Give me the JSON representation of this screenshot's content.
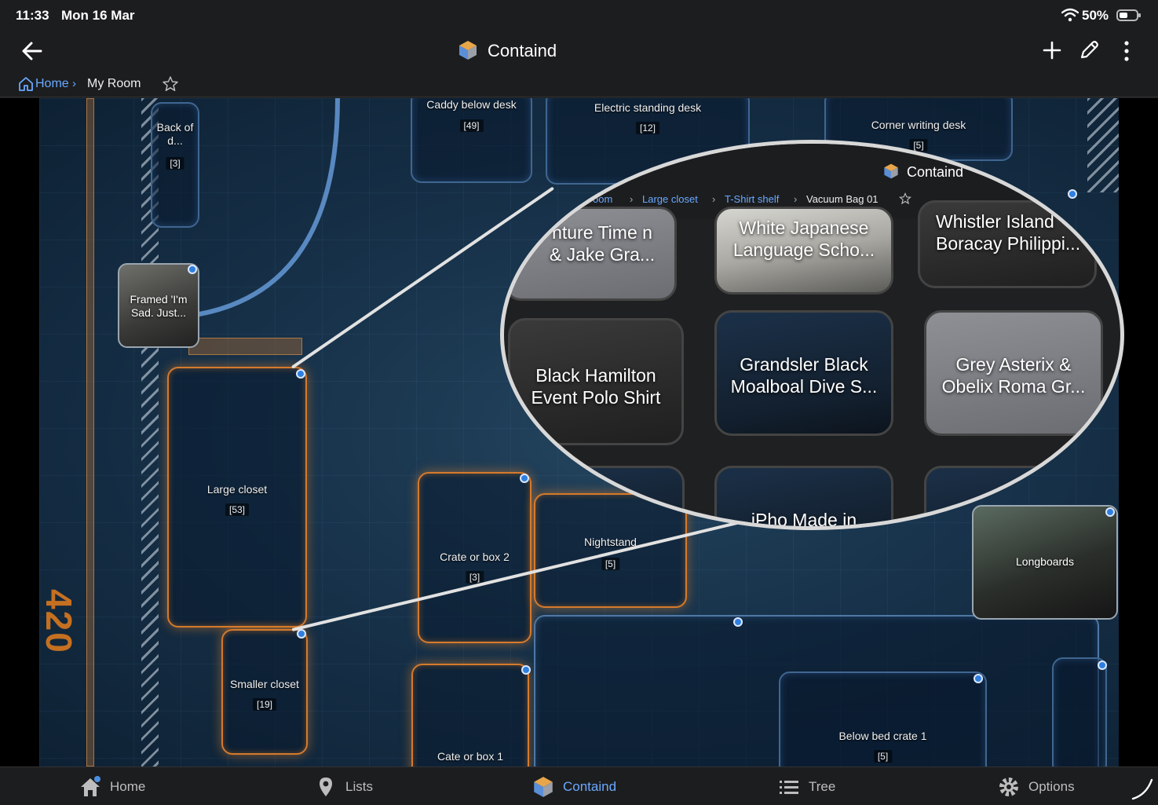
{
  "status_bar": {
    "time": "11:33",
    "date": "Mon 16 Mar",
    "battery": "50%"
  },
  "app_bar": {
    "title": "Containd"
  },
  "breadcrumb": {
    "home": "Home",
    "separator": "›",
    "current": "My Room"
  },
  "map": {
    "floor_number": "420",
    "containers": {
      "caddy": {
        "name": "Caddy below desk",
        "count": "[49]"
      },
      "desk": {
        "name": "Electric standing desk",
        "count": "[12]"
      },
      "corner_desk": {
        "name": "Corner writing desk",
        "count": "[5]"
      },
      "back_door": {
        "name": "Back of d...",
        "count": "[3]"
      },
      "framed": {
        "name": "Framed 'I'm Sad. Just..."
      },
      "large_closet": {
        "name": "Large closet",
        "count": "[53]"
      },
      "smaller_closet": {
        "name": "Smaller closet",
        "count": "[19]"
      },
      "crate2": {
        "name": "Crate or box 2",
        "count": "[3]"
      },
      "crate1": {
        "name": "Cate or box 1"
      },
      "nightstand": {
        "name": "Nightstand",
        "count": "[5]"
      },
      "longboards": {
        "name": "Longboards"
      },
      "below_bed": {
        "name": "Below bed crate 1",
        "count": "[5]"
      }
    }
  },
  "zoom_preview": {
    "title": "Containd",
    "breadcrumb": [
      "oom",
      "›",
      "Large closet",
      "›",
      "T-Shirt shelf",
      "›",
      "Vacuum Bag 01"
    ],
    "items": [
      {
        "label": "nture Time n & Jake Gra..."
      },
      {
        "label": "White Japanese Language Scho..."
      },
      {
        "label": "Whistler Island Boracay Philippi..."
      },
      {
        "label": "Black Hamilton Event Polo Shirt"
      },
      {
        "label": "Grandsler Black Moalboal Dive S..."
      },
      {
        "label": "Grey Asterix & Obelix Roma Gr..."
      },
      {
        "label": "iPho Made in"
      }
    ]
  },
  "bottom_nav": [
    {
      "label": "Home",
      "icon": "house-icon"
    },
    {
      "label": "Lists",
      "icon": "pin-icon"
    },
    {
      "label": "Containd",
      "icon": "cube-logo-icon",
      "active": true
    },
    {
      "label": "Tree",
      "icon": "list-icon"
    },
    {
      "label": "Options",
      "icon": "gear-icon"
    }
  ],
  "colors": {
    "accent": "#6aa9ff",
    "glow_orange": "#d57a2c",
    "map_blue": "#17324a"
  }
}
